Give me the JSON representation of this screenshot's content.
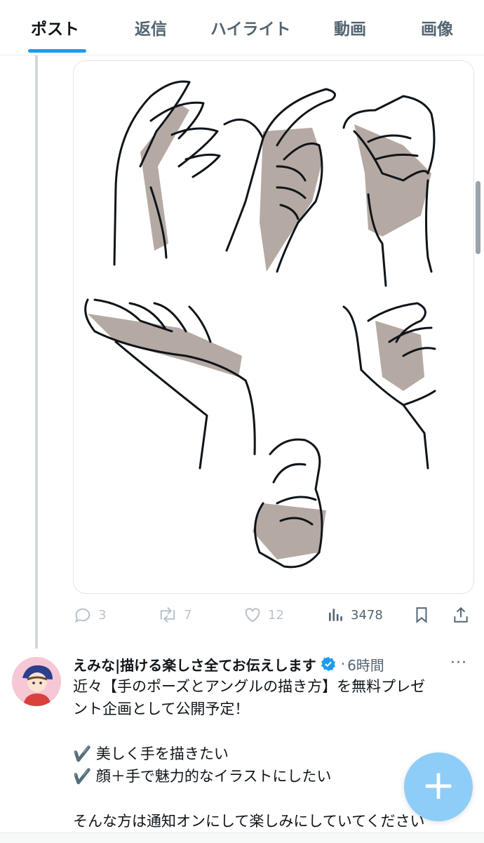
{
  "tabs": [
    {
      "label": "ポスト",
      "active": true
    },
    {
      "label": "返信",
      "active": false
    },
    {
      "label": "ハイライト",
      "active": false
    },
    {
      "label": "動画",
      "active": false
    },
    {
      "label": "画像",
      "active": false
    }
  ],
  "media": {
    "description_icon": "hand-poses-illustration"
  },
  "actions": {
    "reply_count": "3",
    "repost_count": "7",
    "like_count": "12",
    "views_count": "3478"
  },
  "post": {
    "author": "えみな|描ける楽しさ全てお伝えします",
    "separator": "·",
    "time": "6時間",
    "more": "···",
    "lines": [
      "近々【手のポーズとアングルの描き方】を無料プレゼ",
      "ント企画として公開予定！",
      "",
      "✔️ 美しく手を描きたい",
      "✔️ 顔＋手で魅力的なイラストにしたい",
      "",
      "そんな方は通知オンにして楽しみにしていてください"
    ]
  },
  "fab": {
    "label": "+"
  },
  "colors": {
    "accent": "#1d9bf0",
    "muted": "#536471",
    "fab": "#8ecdf8",
    "shade": "#b5a9a3"
  }
}
